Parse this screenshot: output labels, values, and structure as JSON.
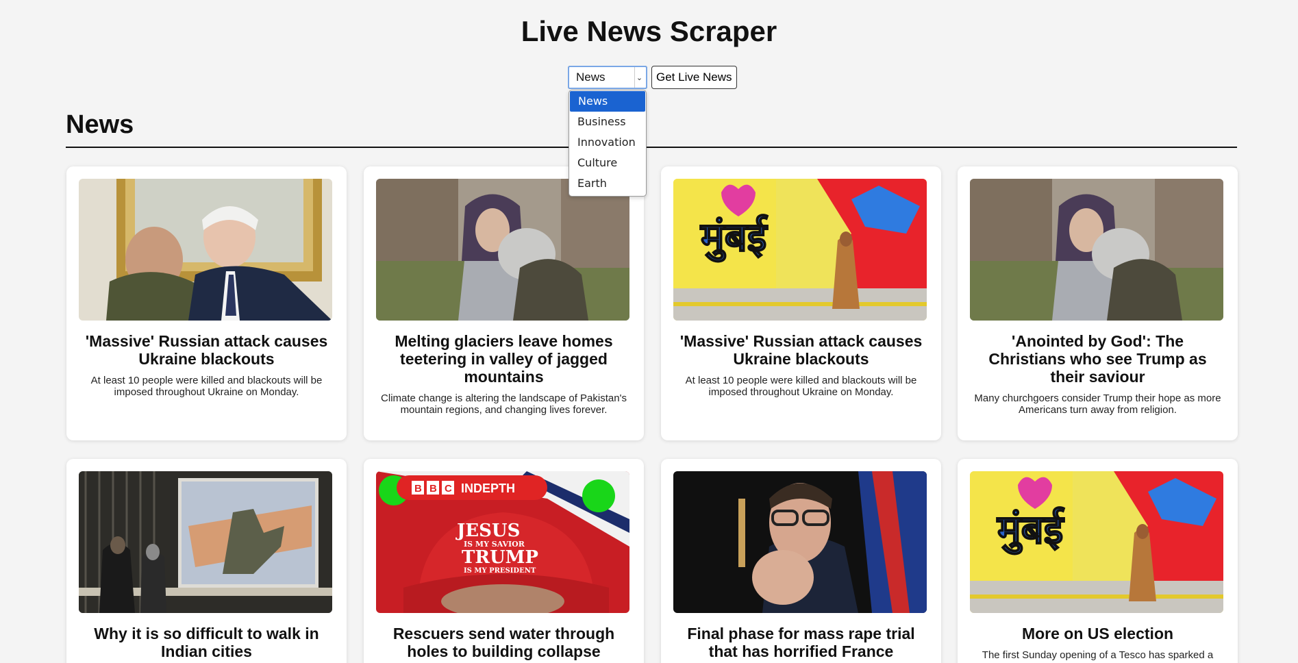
{
  "app": {
    "title": "Live News Scraper"
  },
  "controls": {
    "selected_category": "News",
    "get_button_label": "Get Live News",
    "dropdown_arrow": "chevron-down-icon",
    "options": [
      "News",
      "Business",
      "Innovation",
      "Culture",
      "Earth"
    ]
  },
  "section": {
    "title": "News"
  },
  "cards": [
    {
      "title": "'Massive' Russian attack causes Ukraine blackouts",
      "description": "At least 10 people were killed and blackouts will be imposed throughout Ukraine on Monday."
    },
    {
      "title": "Melting glaciers leave homes teetering in valley of jagged mountains",
      "description": "Climate change is altering the landscape of Pakistan's mountain regions, and changing lives forever."
    },
    {
      "title": "'Massive' Russian attack causes Ukraine blackouts",
      "description": "At least 10 people were killed and blackouts will be imposed throughout Ukraine on Monday."
    },
    {
      "title": "'Anointed by God': The Christians who see Trump as their saviour",
      "description": "Many churchgoers consider Trump their hope as more Americans turn away from religion."
    },
    {
      "title": "Why it is so difficult to walk in Indian cities",
      "description": ""
    },
    {
      "title": "Rescuers send water through holes to building collapse trapped",
      "description": ""
    },
    {
      "title": "Final phase for mass rape trial that has horrified France",
      "description": ""
    },
    {
      "title": "More on US election",
      "description": "The first Sunday opening of a Tesco has sparked a row"
    }
  ],
  "image_text": {
    "mumbai": "मुंबई",
    "bbc": [
      "B",
      "B",
      "C"
    ],
    "indepth": "INDEPTH",
    "cap": [
      "JESUS",
      "IS MY SAVIOR",
      "TRUMP",
      "IS MY PRESIDENT"
    ]
  },
  "colors": {
    "accent": "#1a63d1",
    "background": "#f4f4f4",
    "card": "#ffffff",
    "bbc_red": "#e02424"
  }
}
